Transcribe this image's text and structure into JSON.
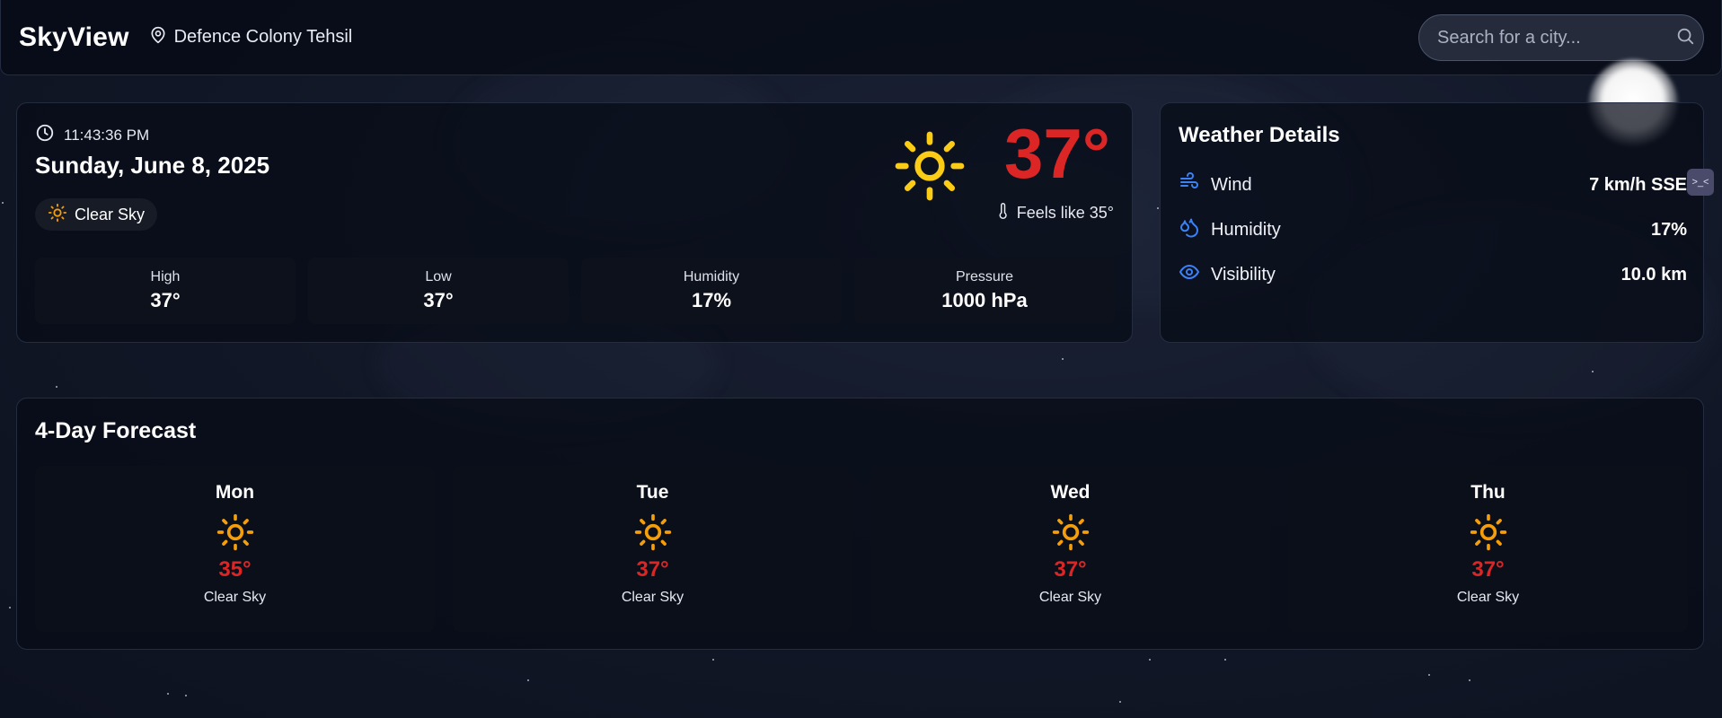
{
  "header": {
    "brand": "SkyView",
    "location": "Defence Colony Tehsil",
    "search_placeholder": "Search for a city..."
  },
  "current": {
    "time": "11:43:36 PM",
    "date": "Sunday, June 8, 2025",
    "condition": "Clear Sky",
    "temperature": "37°",
    "feels_like": "Feels like 35°",
    "stats": [
      {
        "label": "High",
        "value": "37°"
      },
      {
        "label": "Low",
        "value": "37°"
      },
      {
        "label": "Humidity",
        "value": "17%"
      },
      {
        "label": "Pressure",
        "value": "1000 hPa"
      }
    ]
  },
  "details": {
    "title": "Weather Details",
    "rows": [
      {
        "label": "Wind",
        "value": "7 km/h SSE",
        "icon": "wind-icon"
      },
      {
        "label": "Humidity",
        "value": "17%",
        "icon": "droplets-icon"
      },
      {
        "label": "Visibility",
        "value": "10.0 km",
        "icon": "eye-icon"
      }
    ]
  },
  "forecast": {
    "title": "4-Day Forecast",
    "days": [
      {
        "day": "Mon",
        "temp": "35°",
        "condition": "Clear Sky"
      },
      {
        "day": "Tue",
        "temp": "37°",
        "condition": "Clear Sky"
      },
      {
        "day": "Wed",
        "temp": "37°",
        "condition": "Clear Sky"
      },
      {
        "day": "Thu",
        "temp": "37°",
        "condition": "Clear Sky"
      }
    ]
  },
  "colors": {
    "temperature": "#dc2626",
    "sun_large": "#facc15",
    "sun_small": "#f59e0b",
    "detail_icons": "#3b82f6"
  }
}
